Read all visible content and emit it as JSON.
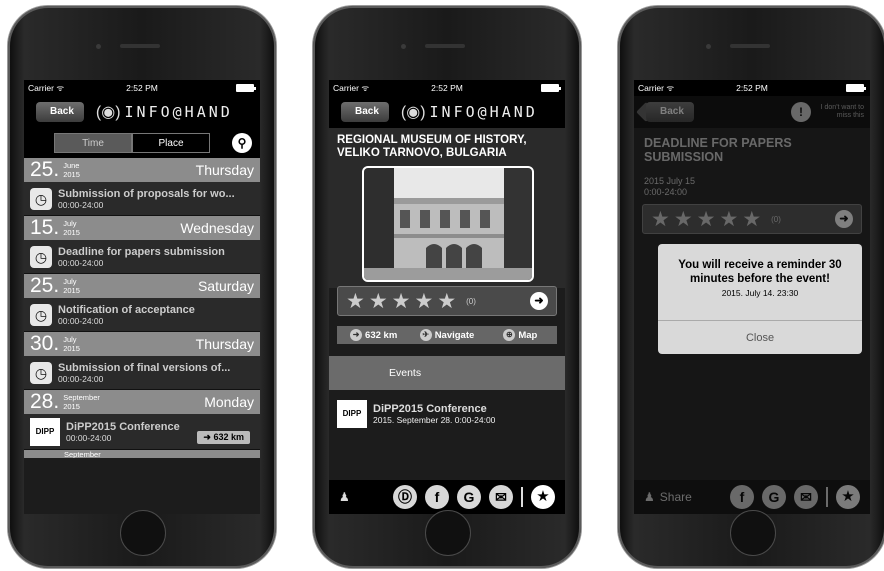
{
  "status": {
    "carrier": "Carrier",
    "time": "2:52 PM"
  },
  "nav": {
    "back_label": "Back",
    "logo_text": "INFO@HAND"
  },
  "screen1": {
    "tabs": [
      {
        "label": "Time"
      },
      {
        "label": "Place"
      }
    ],
    "days": [
      {
        "day": "25",
        "month": "June",
        "year": "2015",
        "weekday": "Thursday",
        "event": {
          "title": "Submission of proposals for wo...",
          "time": "00:00-24:00"
        }
      },
      {
        "day": "15",
        "month": "July",
        "year": "2015",
        "weekday": "Wednesday",
        "event": {
          "title": "Deadline for papers submission",
          "time": "00:00-24:00"
        }
      },
      {
        "day": "25",
        "month": "July",
        "year": "2015",
        "weekday": "Saturday",
        "event": {
          "title": "Notification of acceptance",
          "time": "00:00-24:00"
        }
      },
      {
        "day": "30",
        "month": "July",
        "year": "2015",
        "weekday": "Thursday",
        "event": {
          "title": "Submission of final versions of...",
          "time": "00:00-24:00"
        }
      },
      {
        "day": "28",
        "month": "September",
        "year": "2015",
        "weekday": "Monday",
        "event": {
          "title": "DiPP2015 Conference",
          "time": "00:00-24:00",
          "distance": "632 km",
          "logo": "DIPP"
        }
      }
    ],
    "next_partial_month": "September"
  },
  "screen2": {
    "venue_title": "REGIONAL MUSEUM OF HISTORY, VELIKO TARNOVO, BULGARIA",
    "rating": {
      "value": 0,
      "count": "(0)"
    },
    "actions": {
      "distance": "632 km",
      "navigate": "Navigate",
      "map": "Map"
    },
    "events_tab": "Events",
    "event": {
      "logo": "DIPP",
      "title": "DiPP2015 Conference",
      "when": "2015. September 28. 0:00-24:00"
    }
  },
  "screen3": {
    "title": "DEADLINE FOR PAPERS SUBMISSION",
    "date_line": "2015 July 15",
    "time_line": "0:00-24:00",
    "miss_label": "I don't want to miss this",
    "rating": {
      "count": "(0)"
    },
    "alert": {
      "message": "You will receive a reminder 30 minutes before the event!",
      "date": "2015. July 14. 23:30",
      "close": "Close"
    },
    "share_label": "Share"
  },
  "icons": {
    "wifi": "wifi-icon",
    "search": "search-icon",
    "clock": "clock-icon",
    "arrow": "arrow-right-icon",
    "navigate": "compass-icon",
    "map": "globe-icon",
    "share": "people-icon",
    "dipp": "dipp-icon",
    "facebook": "facebook-icon",
    "google": "google-icon",
    "email": "email-icon",
    "favorite": "star-icon"
  }
}
